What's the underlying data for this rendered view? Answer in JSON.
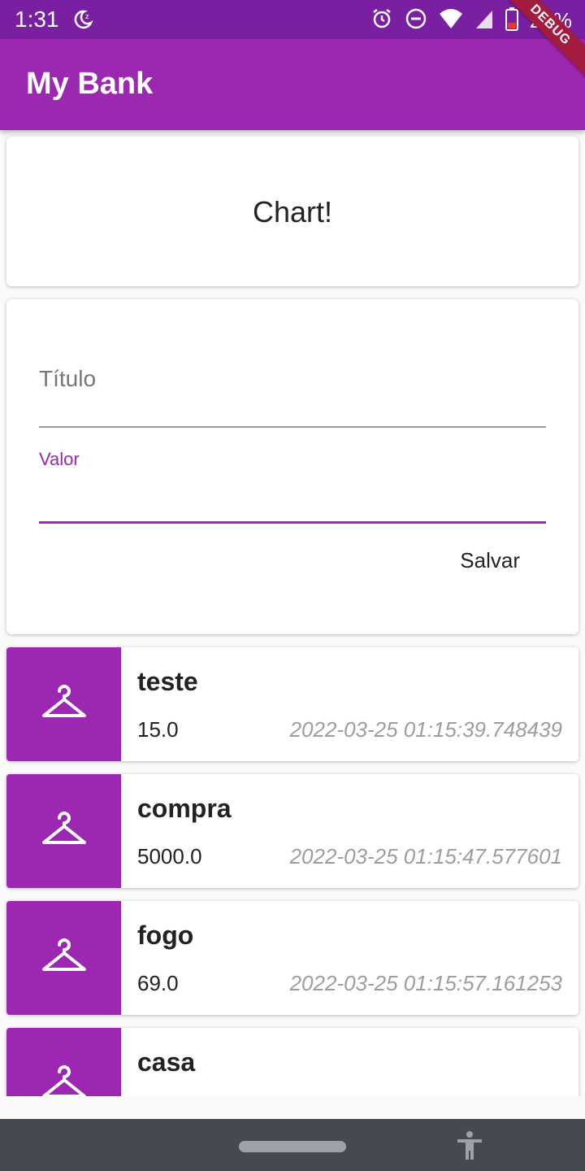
{
  "status_bar": {
    "time": "1:31",
    "battery_percent": "21%"
  },
  "app_bar": {
    "title": "My Bank",
    "debug_banner": "DEBUG"
  },
  "chart_card": {
    "text": "Chart!"
  },
  "form": {
    "title_placeholder": "Título",
    "value_label": "Valor",
    "save_label": "Salvar"
  },
  "transactions": [
    {
      "title": "teste",
      "value": "15.0",
      "date": "2022-03-25 01:15:39.748439",
      "icon": "hanger-icon"
    },
    {
      "title": "compra",
      "value": "5000.0",
      "date": "2022-03-25 01:15:47.577601",
      "icon": "hanger-icon"
    },
    {
      "title": "fogo",
      "value": "69.0",
      "date": "2022-03-25 01:15:57.161253",
      "icon": "hanger-icon"
    },
    {
      "title": "casa",
      "icon": "hanger-icon"
    }
  ],
  "colors": {
    "primary": "#9c27b0",
    "status_bar": "#7b1fa2",
    "nav_bar": "#454a50"
  }
}
